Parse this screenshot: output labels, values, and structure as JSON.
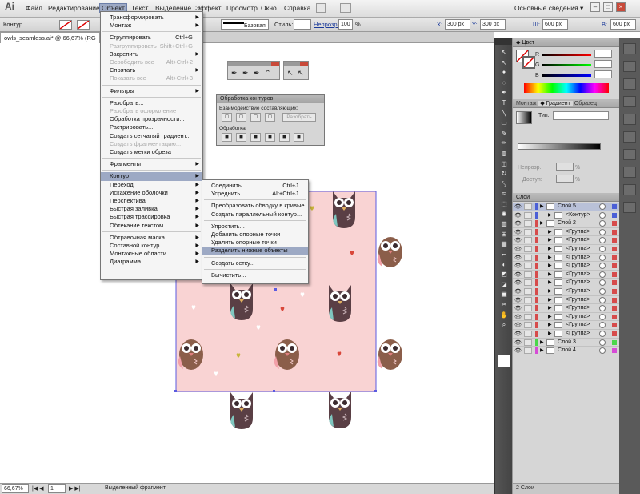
{
  "app": {
    "logo": "Ai"
  },
  "menubar": {
    "items": [
      "Файл",
      "Редактирование",
      "Объект",
      "Текст",
      "Выделение",
      "Эффект",
      "Просмотр",
      "Окно",
      "Справка"
    ],
    "workspace": "Основные сведения ▾"
  },
  "control_bar": {
    "object_type": "Контур",
    "stroke_style": "Базовая",
    "style_label": "Стиль:",
    "opacity_label": "Непрозр.:",
    "opacity_value": "100",
    "opacity_unit": "%",
    "x_value": "300 px",
    "y_value": "300 px",
    "w_value": "600 px",
    "h_value": "600 px",
    "x_label": "X:",
    "y_label": "Y:",
    "w_label": "Ш:",
    "h_label": "В:"
  },
  "document": {
    "tab_title": "owls_seamless.ai* @ 66,67% (RG"
  },
  "status": {
    "zoom": "66,67%",
    "page": "1",
    "selection_label": "Выделенный фрагмент"
  },
  "object_menu": {
    "items": [
      {
        "label": "Трансформировать",
        "sub": true
      },
      {
        "label": "Монтаж",
        "sub": true
      },
      {
        "sep": true
      },
      {
        "label": "Сгруппировать",
        "shortcut": "Ctrl+G"
      },
      {
        "label": "Разгруппировать",
        "shortcut": "Shift+Ctrl+G",
        "disabled": true
      },
      {
        "label": "Закрепить",
        "sub": true
      },
      {
        "label": "Освободить все",
        "shortcut": "Alt+Ctrl+2",
        "disabled": true
      },
      {
        "label": "Спрятать",
        "sub": true
      },
      {
        "label": "Показать все",
        "shortcut": "Alt+Ctrl+3",
        "disabled": true
      },
      {
        "sep": true
      },
      {
        "label": "Фильтры",
        "sub": true
      },
      {
        "sep": true
      },
      {
        "label": "Разобрать..."
      },
      {
        "label": "Разобрать оформление",
        "disabled": true
      },
      {
        "label": "Обработка прозрачности..."
      },
      {
        "label": "Растрировать..."
      },
      {
        "label": "Создать сетчатый градиент..."
      },
      {
        "label": "Создать фрагментацию...",
        "disabled": true
      },
      {
        "label": "Создать метки обреза"
      },
      {
        "sep": true
      },
      {
        "label": "Фрагменты",
        "sub": true
      },
      {
        "sep": true
      },
      {
        "label": "Контур",
        "sub": true,
        "highlight": true
      },
      {
        "label": "Переход",
        "sub": true
      },
      {
        "label": "Искажение оболочки",
        "sub": true
      },
      {
        "label": "Перспектива",
        "sub": true
      },
      {
        "label": "Быстрая заливка",
        "sub": true
      },
      {
        "label": "Быстрая трассировка",
        "sub": true
      },
      {
        "label": "Обтекание текстом",
        "sub": true
      },
      {
        "sep": true
      },
      {
        "label": "Обтравочная маска",
        "sub": true
      },
      {
        "label": "Составной контур",
        "sub": true
      },
      {
        "label": "Монтажные области",
        "sub": true
      },
      {
        "label": "Диаграмма",
        "sub": true
      }
    ]
  },
  "path_submenu": {
    "items": [
      {
        "label": "Соединить",
        "shortcut": "Ctrl+J"
      },
      {
        "label": "Усреднить...",
        "shortcut": "Alt+Ctrl+J"
      },
      {
        "sep": true
      },
      {
        "label": "Преобразовать обводку в кривые"
      },
      {
        "label": "Создать параллельный контур..."
      },
      {
        "sep": true
      },
      {
        "label": "Упростить..."
      },
      {
        "label": "Добавить опорные точки"
      },
      {
        "label": "Удалить опорные точки"
      },
      {
        "label": "Разделить нижние объекты",
        "highlight": true
      },
      {
        "sep": true
      },
      {
        "label": "Создать сетку..."
      },
      {
        "sep": true
      },
      {
        "label": "Вычистить..."
      }
    ]
  },
  "pathfinder": {
    "title": "Обработка контуров",
    "shape_modes_label": "Взаимодействие составляющих:",
    "expand_button": "Разобрать",
    "pathfinders_label": "Обработка"
  },
  "color_panel": {
    "title": "Цвет",
    "channels": [
      "R",
      "G",
      "B"
    ]
  },
  "gradient_panel": {
    "tabs": [
      "Монтаж",
      "Градиент",
      "Образец"
    ],
    "type_label": "Тип:",
    "opacity_label": "Непрозр.:",
    "location_label": "Доступ:",
    "opacity_unit": "%"
  },
  "layers_panel": {
    "title": "Слои",
    "rows": [
      {
        "label": "Слой 5",
        "level": 0,
        "color": "#4b5fd6",
        "selected": true
      },
      {
        "label": "<Контур>",
        "level": 1,
        "color": "#4b5fd6"
      },
      {
        "label": "Слой 2",
        "level": 0,
        "color": "#d64b4b"
      },
      {
        "label": "<Группа>",
        "level": 1,
        "color": "#d64b4b"
      },
      {
        "label": "<Группа>",
        "level": 1,
        "color": "#d64b4b"
      },
      {
        "label": "<Группа>",
        "level": 1,
        "color": "#d64b4b"
      },
      {
        "label": "<Группа>",
        "level": 1,
        "color": "#d64b4b"
      },
      {
        "label": "<Группа>",
        "level": 1,
        "color": "#d64b4b"
      },
      {
        "label": "<Группа>",
        "level": 1,
        "color": "#d64b4b"
      },
      {
        "label": "<Группа>",
        "level": 1,
        "color": "#d64b4b"
      },
      {
        "label": "<Группа>",
        "level": 1,
        "color": "#d64b4b"
      },
      {
        "label": "<Группа>",
        "level": 1,
        "color": "#d64b4b"
      },
      {
        "label": "<Группа>",
        "level": 1,
        "color": "#d64b4b"
      },
      {
        "label": "<Группа>",
        "level": 1,
        "color": "#d64b4b"
      },
      {
        "label": "<Группа>",
        "level": 1,
        "color": "#d64b4b"
      },
      {
        "label": "<Группа>",
        "level": 1,
        "color": "#d64b4b"
      },
      {
        "label": "Слой 3",
        "level": 0,
        "color": "#4bd64b"
      },
      {
        "label": "Слой 4",
        "level": 0,
        "color": "#d64bd6"
      }
    ],
    "footer": "2 Слои"
  },
  "colors": {
    "artboard_pink": "#f9d3d3",
    "owl_brown": "#8b5e4a",
    "owl_dark": "#5a3f45",
    "owl_teal": "#7fc7c0",
    "heart_red": "#d9473a",
    "heart_olive": "#c8b43a",
    "selection_blue": "#5b5be0"
  }
}
